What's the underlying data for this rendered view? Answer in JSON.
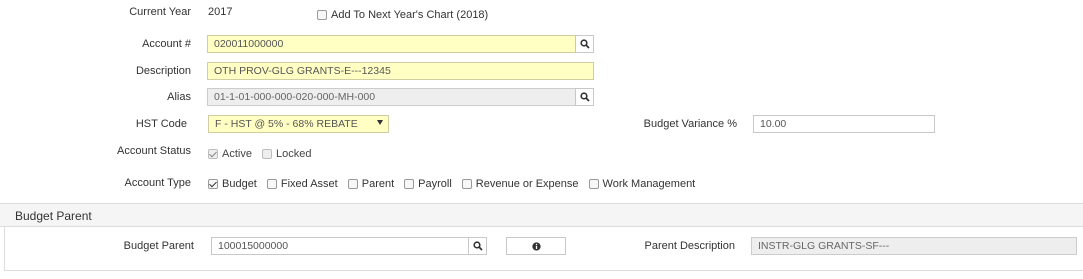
{
  "current_year": {
    "label": "Current Year",
    "value": "2017"
  },
  "add_next_year": {
    "label": "Add To Next Year's Chart (2018)",
    "checked": false
  },
  "account_number": {
    "label": "Account #",
    "value": "020011000000"
  },
  "description": {
    "label": "Description",
    "value": "OTH PROV-GLG GRANTS-E---12345"
  },
  "alias": {
    "label": "Alias",
    "value": "01-1-01-000-000-020-000-MH-000"
  },
  "hst_code": {
    "label": "HST Code",
    "value": "F - HST @ 5% - 68% REBATE"
  },
  "budget_variance": {
    "label": "Budget Variance %",
    "value": "10.00"
  },
  "account_status": {
    "label": "Account Status",
    "options": [
      {
        "label": "Active",
        "checked": true
      },
      {
        "label": "Locked",
        "checked": false
      }
    ]
  },
  "account_type": {
    "label": "Account Type",
    "options": [
      {
        "label": "Budget",
        "checked": true
      },
      {
        "label": "Fixed Asset",
        "checked": false
      },
      {
        "label": "Parent",
        "checked": false
      },
      {
        "label": "Payroll",
        "checked": false
      },
      {
        "label": "Revenue or Expense",
        "checked": false
      },
      {
        "label": "Work Management",
        "checked": false
      }
    ]
  },
  "budget_parent_panel": {
    "title": "Budget Parent",
    "field_label": "Budget Parent",
    "value": "100015000000",
    "parent_description_label": "Parent Description",
    "parent_description_value": "INSTR-GLG GRANTS-SF---"
  },
  "icons": {
    "search": "search-icon",
    "info": "info-icon",
    "dropdown": "caret-down-icon"
  }
}
